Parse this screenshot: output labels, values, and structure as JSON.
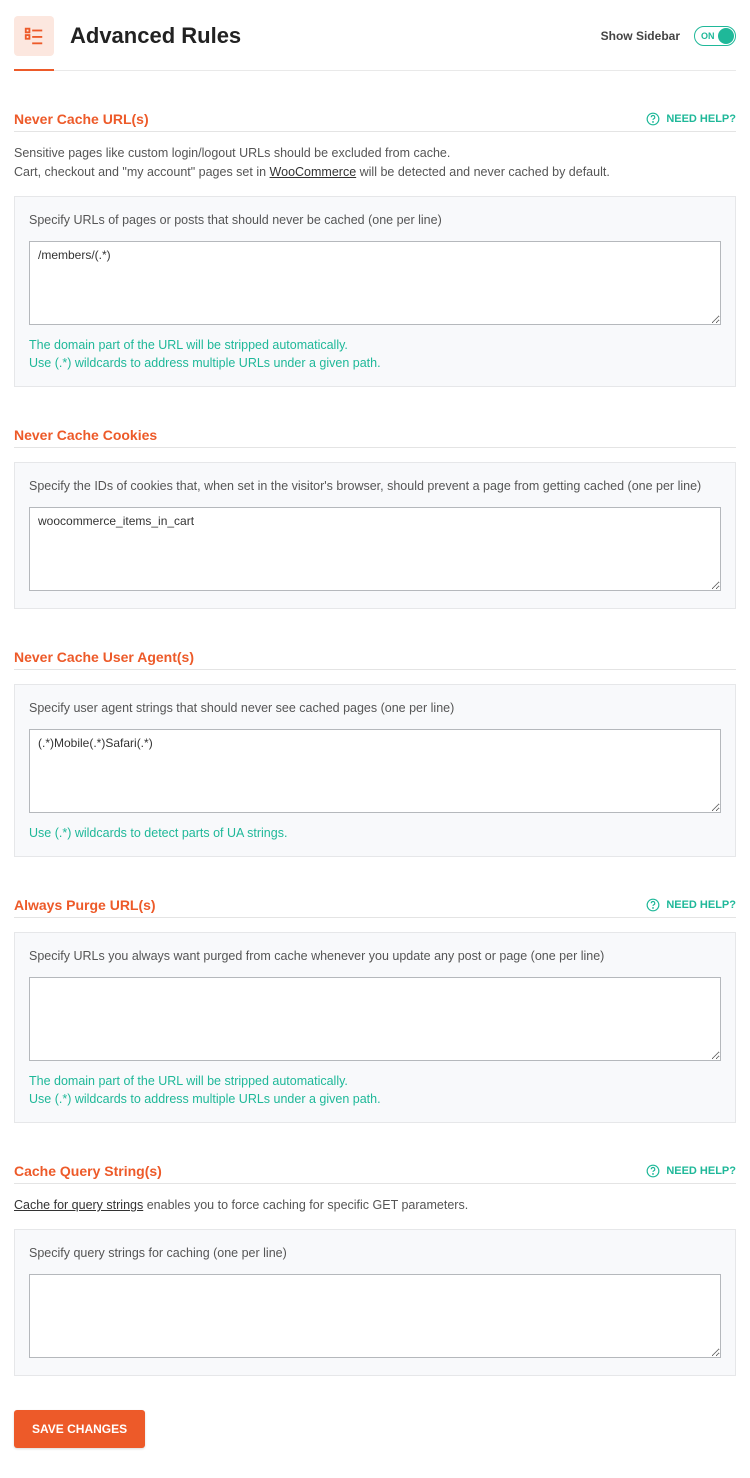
{
  "header": {
    "title": "Advanced Rules",
    "show_sidebar_label": "Show Sidebar",
    "toggle_state": "ON"
  },
  "need_help_label": "NEED HELP?",
  "sections": {
    "never_cache_urls": {
      "title": "Never Cache URL(s)",
      "show_help": true,
      "desc_line1": "Sensitive pages like custom login/logout URLs should be excluded from cache.",
      "desc_line2_pre": "Cart, checkout and \"my account\" pages set in ",
      "desc_line2_link": "WooCommerce",
      "desc_line2_post": " will be detected and never cached by default.",
      "box_label": "Specify URLs of pages or posts that should never be cached (one per line)",
      "value": "/members/(.*)",
      "rows": 5,
      "hint_line1": "The domain part of the URL will be stripped automatically.",
      "hint_line2": "Use (.*) wildcards to address multiple URLs under a given path."
    },
    "never_cache_cookies": {
      "title": "Never Cache Cookies",
      "box_label": "Specify the IDs of cookies that, when set in the visitor's browser, should prevent a page from getting cached (one per line)",
      "value": "woocommerce_items_in_cart",
      "rows": 5
    },
    "never_cache_ua": {
      "title": "Never Cache User Agent(s)",
      "box_label": "Specify user agent strings that should never see cached pages (one per line)",
      "value": "(.*)Mobile(.*)Safari(.*)",
      "rows": 5,
      "hint_line1": "Use (.*) wildcards to detect parts of UA strings."
    },
    "always_purge": {
      "title": "Always Purge URL(s)",
      "show_help": true,
      "box_label": "Specify URLs you always want purged from cache whenever you update any post or page (one per line)",
      "value": "",
      "rows": 5,
      "hint_line1": "The domain part of the URL will be stripped automatically.",
      "hint_line2": "Use (.*) wildcards to address multiple URLs under a given path."
    },
    "cache_query": {
      "title": "Cache Query String(s)",
      "show_help": true,
      "desc_link": "Cache for query strings",
      "desc_post": " enables you to force caching for specific GET parameters.",
      "box_label": "Specify query strings for caching (one per line)",
      "value": "",
      "rows": 5
    }
  },
  "save_button": "SAVE CHANGES"
}
